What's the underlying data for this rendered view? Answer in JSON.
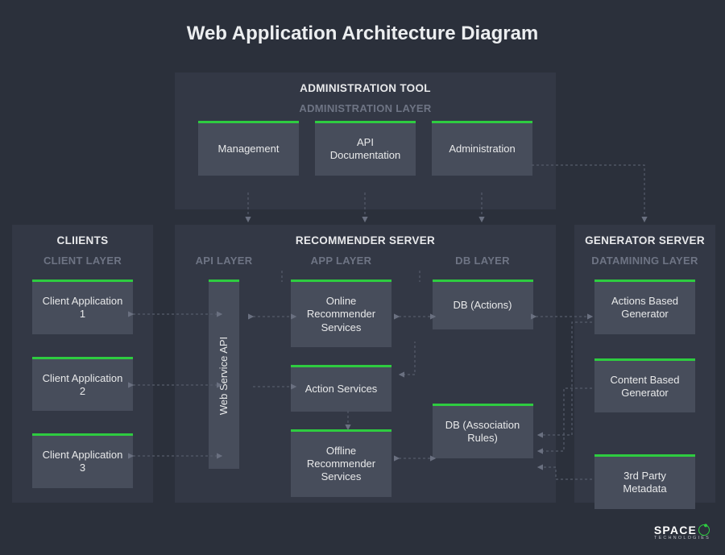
{
  "title": "Web Application Architecture Diagram",
  "admin": {
    "heading": "ADMINISTRATION TOOL",
    "layer": "ADMINISTRATION LAYER",
    "boxes": {
      "management": "Management",
      "api_docs": "API Documentation",
      "administration": "Administration"
    }
  },
  "clients": {
    "heading": "CLIIENTS",
    "layer": "CLIENT LAYER",
    "boxes": {
      "app1": "Client Application 1",
      "app2": "Client Application 2",
      "app3": "Client Application 3"
    }
  },
  "recommender": {
    "heading": "RECOMMENDER SERVER",
    "api": {
      "layer": "API LAYER",
      "box": "Web  Service API"
    },
    "app": {
      "layer": "APP LAYER",
      "boxes": {
        "online_rec": "Online Recommender Services",
        "action_services": "Action Services",
        "offline_rec": "Offline Recommender Services"
      }
    },
    "db": {
      "layer": "DB LAYER",
      "boxes": {
        "actions": "DB (Actions)",
        "assoc": "DB (Association Rules)"
      }
    }
  },
  "generator": {
    "heading": "GENERATOR SERVER",
    "layer": "DATAMINING LAYER",
    "boxes": {
      "actions_based": "Actions Based Generator",
      "content_based": "Content Based Generator",
      "third_party": "3rd Party Metadata"
    }
  },
  "brand": {
    "name": "SPACE",
    "sub": "TECHNOLOGIES"
  },
  "colors": {
    "accent": "#2ecc40",
    "bg": "#2b303b",
    "panel": "#333845",
    "box": "#474d5b"
  }
}
